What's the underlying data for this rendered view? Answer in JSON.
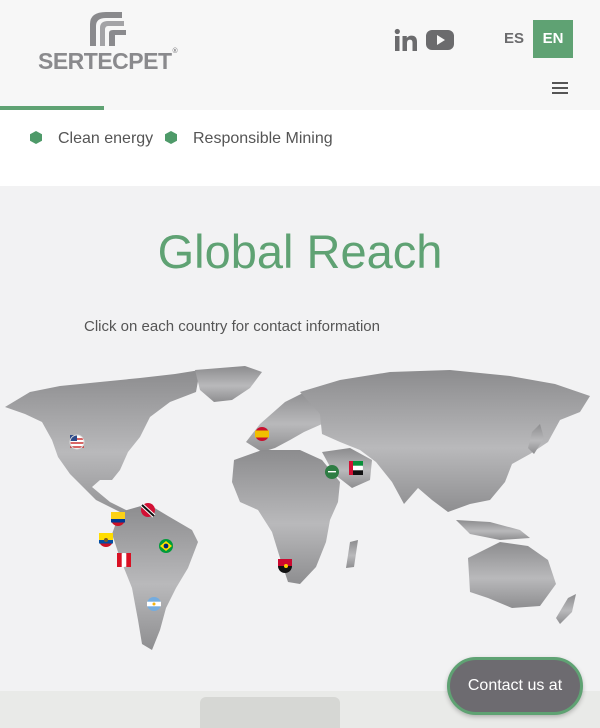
{
  "header": {
    "logo_text": "SERTECPET",
    "logo_mark": "®",
    "social": [
      "linkedin-icon",
      "youtube-icon"
    ],
    "lang_es": "ES",
    "lang_en": "EN",
    "menu_icon": "hamburger-menu-icon",
    "accent": "#5fa273"
  },
  "tags": [
    "Clean energy",
    "Responsible Mining"
  ],
  "section": {
    "title": "Global Reach",
    "subtitle": "Click on each country for contact information"
  },
  "map": {
    "flags": [
      "us-flag",
      "spain-flag",
      "saudi-arabia-flag",
      "uae-flag",
      "trinidad-and-tobago-flag",
      "colombia-flag",
      "ecuador-flag",
      "brazil-flag",
      "peru-flag",
      "angola-flag",
      "argentina-flag"
    ]
  },
  "contact_label": "Contact us at"
}
